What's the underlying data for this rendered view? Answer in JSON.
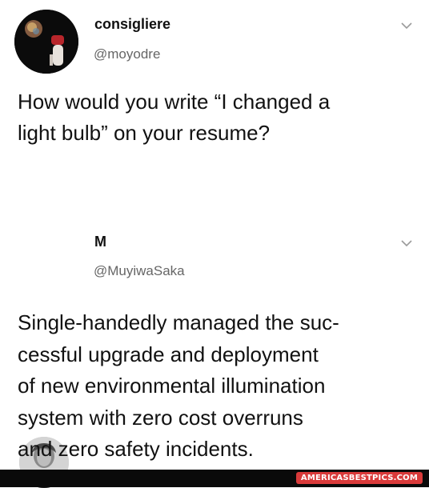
{
  "tweets": [
    {
      "display_name": "consigliere",
      "handle": "@moyodre",
      "text": "How would you write “I changed a\nlight bulb” on your resume?",
      "avatar_icon": "profile-photo-icon",
      "menu_icon": "chevron-down-icon"
    },
    {
      "display_name": "M",
      "handle": "@MuyiwaSaka",
      "text": "Single-handedly managed the suc-\ncessful upgrade and deployment\nof new environmental illumination\nsystem with zero cost overruns\nand zero safety incidents.",
      "avatar_icon": "portrait-photo-icon",
      "menu_icon": "chevron-down-icon"
    }
  ],
  "footer": {
    "watermark": "AMERICASBESTPICS.COM"
  },
  "colors": {
    "text": "#111111",
    "handle": "#666666",
    "watermark_bg": "#d93a3a",
    "footer_bg": "#0a0a0a"
  }
}
